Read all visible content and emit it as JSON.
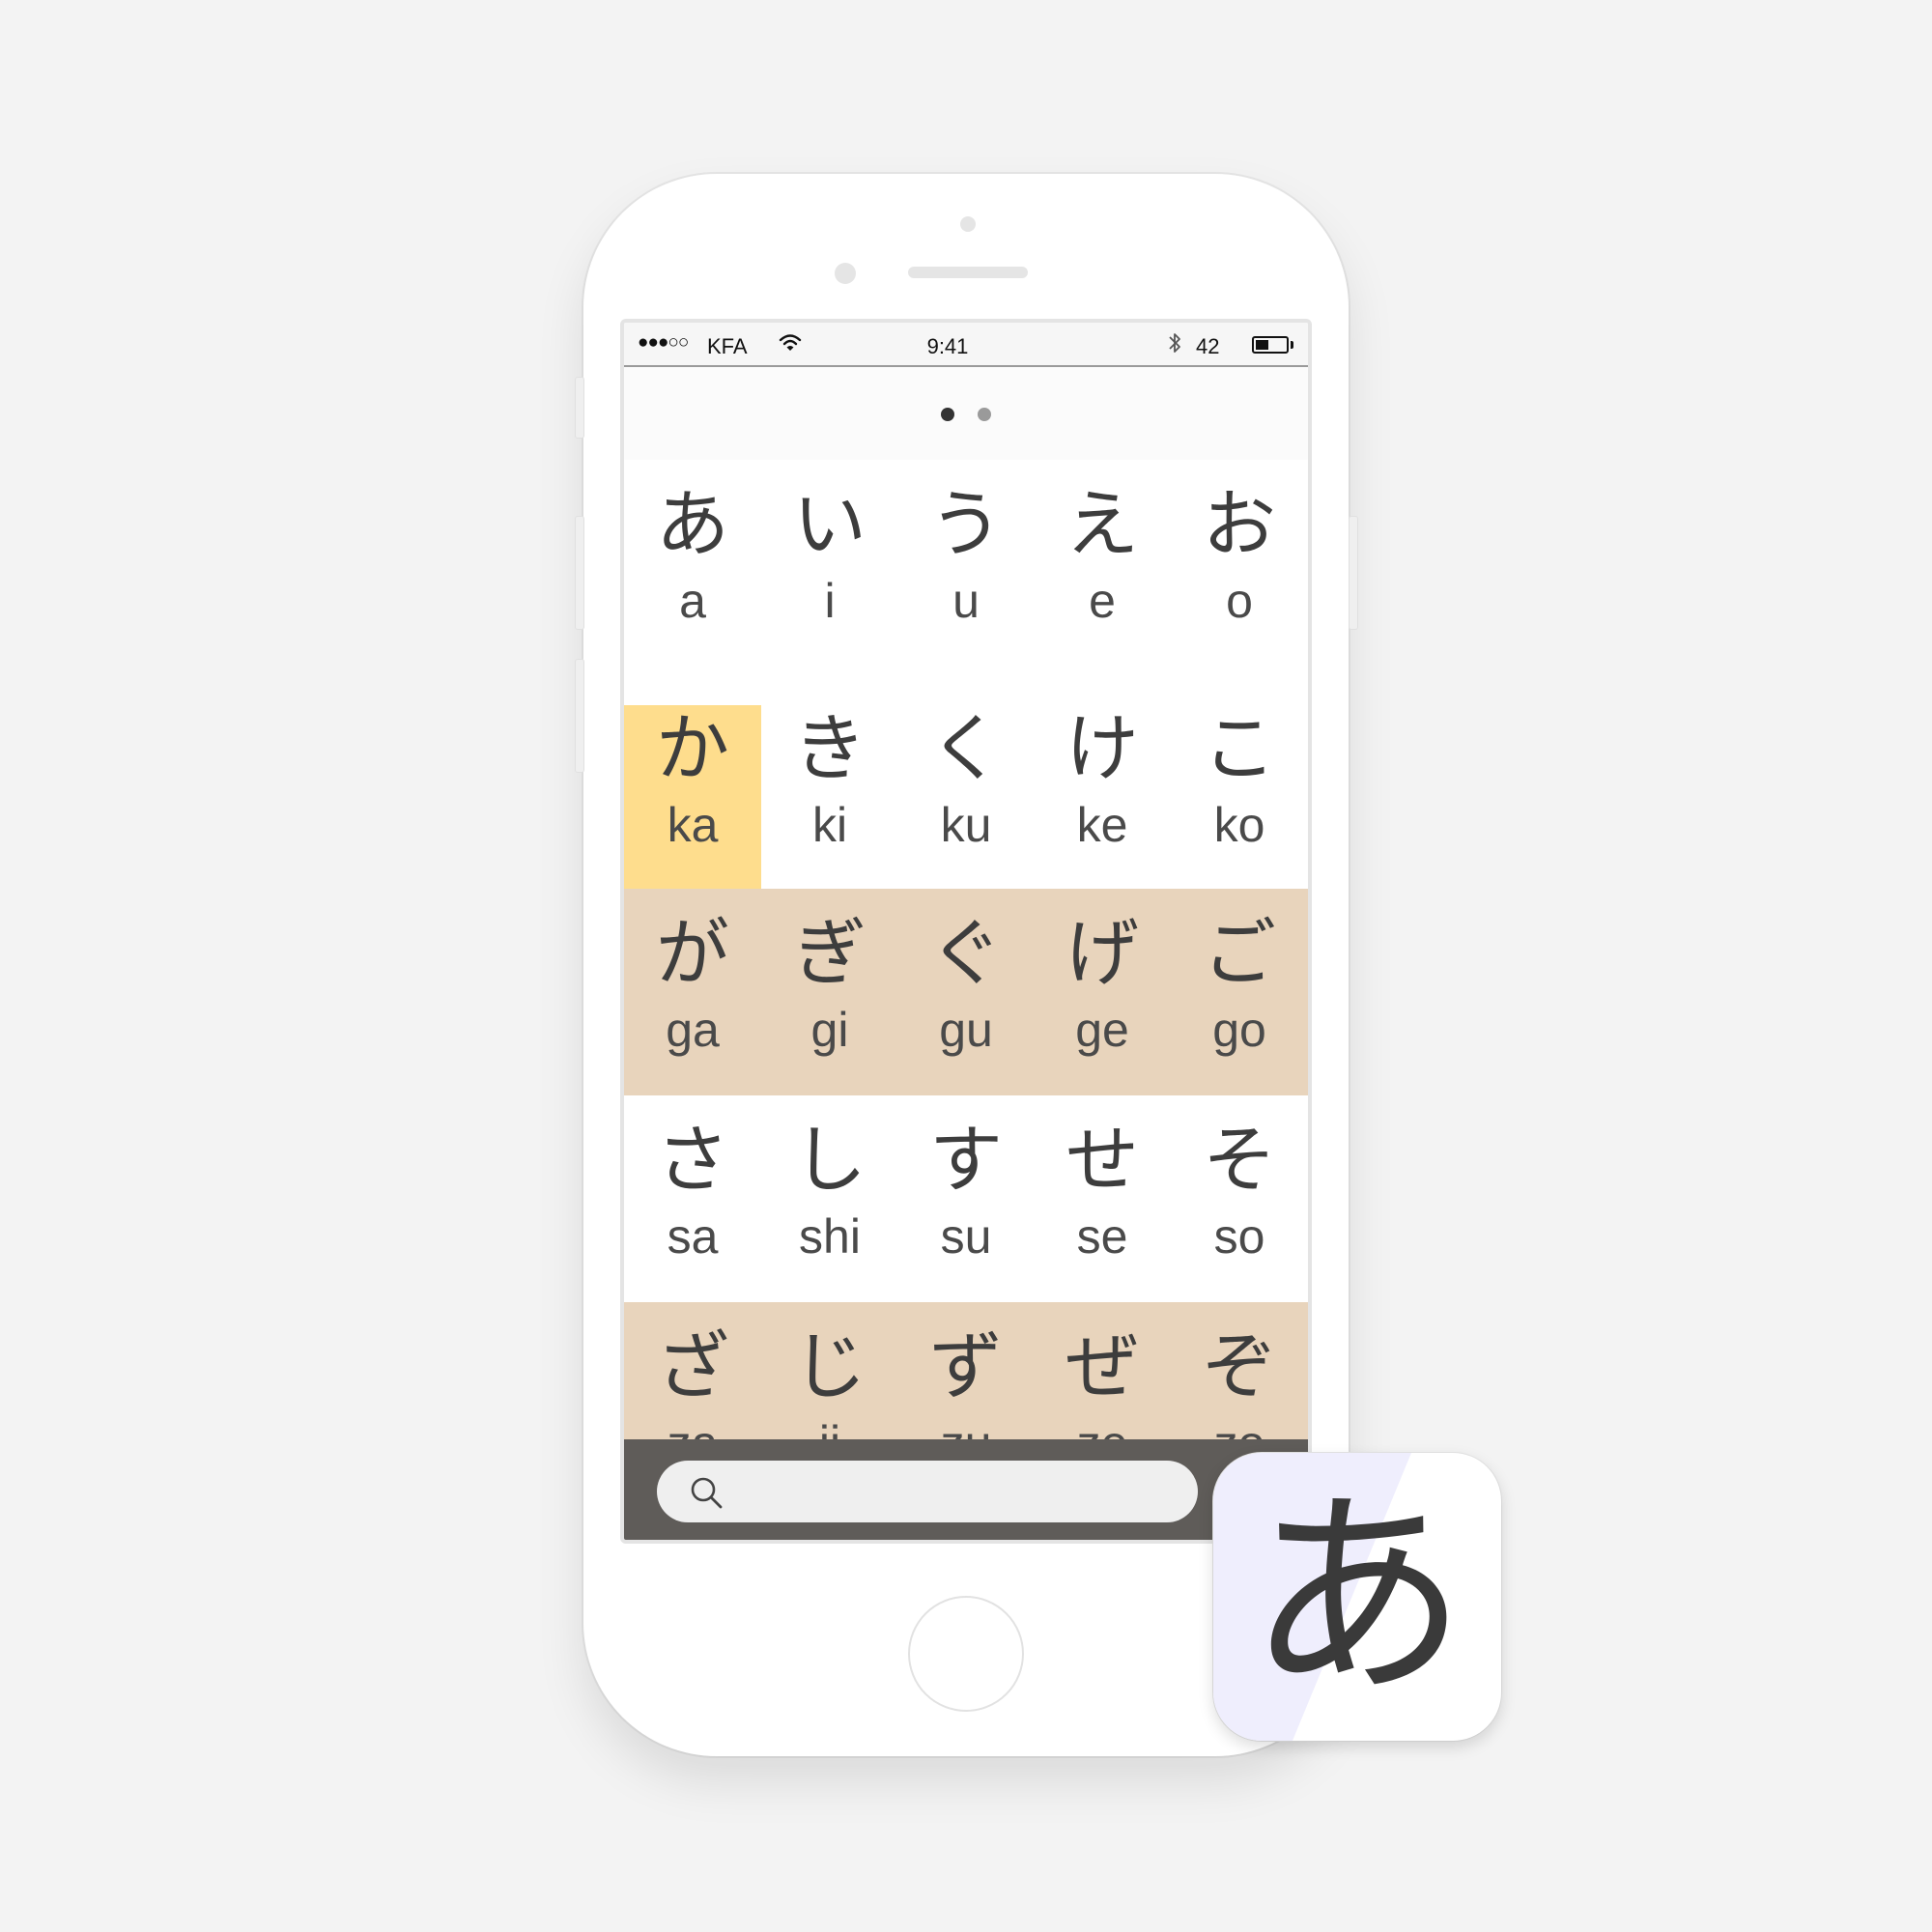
{
  "status_bar": {
    "signal": "●●●○○",
    "carrier": "KFA",
    "time": "9:41",
    "battery_percent": "42",
    "battery_level": 0.42
  },
  "pager": {
    "page_count": 2,
    "active_page": 1,
    "active_color": "#333333",
    "inactive_color": "#9a9a9a"
  },
  "kana_rows": [
    {
      "shade": "white",
      "cells": [
        {
          "kana": "あ",
          "roma": "a"
        },
        {
          "kana": "い",
          "roma": "i"
        },
        {
          "kana": "う",
          "roma": "u"
        },
        {
          "kana": "え",
          "roma": "e"
        },
        {
          "kana": "お",
          "roma": "o"
        }
      ]
    },
    {
      "shade": "white",
      "cells": [
        {
          "kana": "か",
          "roma": "ka",
          "selected": true
        },
        {
          "kana": "き",
          "roma": "ki"
        },
        {
          "kana": "く",
          "roma": "ku"
        },
        {
          "kana": "け",
          "roma": "ke"
        },
        {
          "kana": "こ",
          "roma": "ko"
        }
      ]
    },
    {
      "shade": "dakuten",
      "cells": [
        {
          "kana": "が",
          "roma": "ga"
        },
        {
          "kana": "ぎ",
          "roma": "gi"
        },
        {
          "kana": "ぐ",
          "roma": "gu"
        },
        {
          "kana": "げ",
          "roma": "ge"
        },
        {
          "kana": "ご",
          "roma": "go"
        }
      ]
    },
    {
      "shade": "white",
      "cells": [
        {
          "kana": "さ",
          "roma": "sa"
        },
        {
          "kana": "し",
          "roma": "shi"
        },
        {
          "kana": "す",
          "roma": "su"
        },
        {
          "kana": "せ",
          "roma": "se"
        },
        {
          "kana": "そ",
          "roma": "so"
        }
      ]
    },
    {
      "shade": "dakuten",
      "cells": [
        {
          "kana": "ざ",
          "roma": "za"
        },
        {
          "kana": "じ",
          "roma": "ji"
        },
        {
          "kana": "ず",
          "roma": "zu"
        },
        {
          "kana": "ぜ",
          "roma": "ze"
        },
        {
          "kana": "ぞ",
          "roma": "zo"
        }
      ]
    }
  ],
  "colors": {
    "selected_cell": "#fedd8d",
    "dakuten_row": "#e8d4bc",
    "white_row": "#ffffff",
    "search_bar": "#5f5c59",
    "app_icon_tint": "#efeefd"
  },
  "search": {
    "placeholder": "",
    "icon": "search-icon"
  },
  "app_icon": {
    "glyph": "あ"
  }
}
